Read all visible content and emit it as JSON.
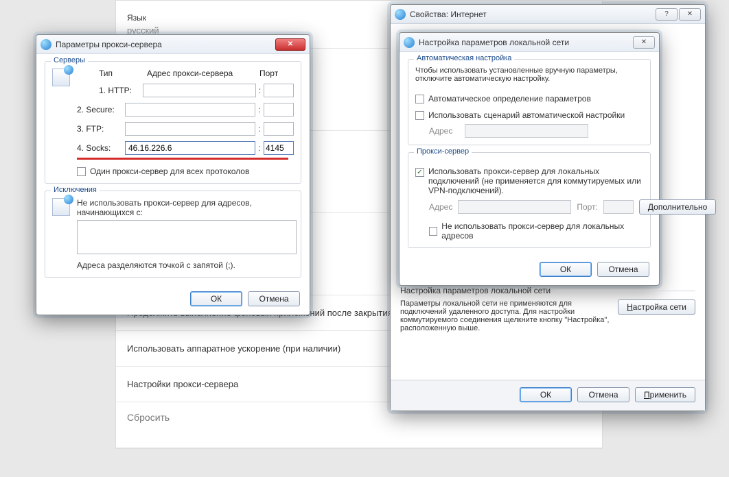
{
  "background": {
    "lang_label": "Язык",
    "lang_value": "русский",
    "row_continue": "Продолжить выполнение фоновых приложений после закрытия",
    "row_hw": "Использовать аппаратное ускорение (при наличии)",
    "row_proxy": "Настройки прокси-сервера",
    "section_reset": "Сбросить"
  },
  "proxyWin": {
    "title": "Параметры прокси-сервера",
    "grp_servers": "Серверы",
    "hdr_type": "Тип",
    "hdr_addr": "Адрес прокси-сервера",
    "hdr_port": "Порт",
    "rows": [
      {
        "label": "1. HTTP:",
        "addr": "",
        "port": ""
      },
      {
        "label": "2. Secure:",
        "addr": "",
        "port": ""
      },
      {
        "label": "3. FTP:",
        "addr": "",
        "port": ""
      },
      {
        "label": "4. Socks:",
        "addr": "46.16.226.6",
        "port": "4145"
      }
    ],
    "chk_one_proxy": "Один прокси-сервер для всех протоколов",
    "grp_excl": "Исключения",
    "excl_note": "Не использовать прокси-сервер для адресов, начинающихся с:",
    "excl_hint": "Адреса разделяются точкой с запятой (;).",
    "ok": "ОК",
    "cancel": "Отмена"
  },
  "inetWin": {
    "title": "Свойства: Интернет",
    "lan_box_title": "Настройка параметров локальной сети",
    "grp_auto": "Автоматическая настройка",
    "auto_note": "Чтобы использовать установленные вручную параметры, отключите автоматическую настройку.",
    "chk_auto_detect": "Автоматическое определение параметров",
    "chk_auto_script": "Использовать сценарий автоматической настройки",
    "addr_label": "Адрес",
    "grp_proxy": "Прокси-сервер",
    "chk_use_proxy": "Использовать прокси-сервер для локальных подключений (не применяется для коммутируемых или VPN-подключений).",
    "port_label": "Порт:",
    "btn_more_pre": "Д",
    "btn_more_rest": "ополнительно",
    "chk_bypass_local": "Не использовать прокси-сервер для локальных адресов",
    "ok": "ОК",
    "cancel": "Отмена",
    "sep_title": "Настройка параметров локальной сети",
    "lan_desc": "Параметры локальной сети не применяются для подключений удаленного доступа. Для настройки коммутируемого соединения щелкните кнопку \"Настройка\", расположенную выше.",
    "btn_lan_pre": "Н",
    "btn_lan_rest": "астройка сети",
    "apply_pre": "П",
    "apply_rest": "рименить"
  }
}
